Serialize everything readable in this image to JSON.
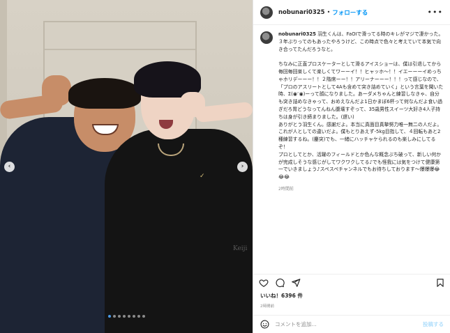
{
  "post": {
    "username": "nobunari0325",
    "follow_label": "フォローする",
    "separator": "•",
    "more_label": "•••",
    "photo_credit": "Keiji",
    "shirt_logo": "✓",
    "carousel": {
      "prev": "‹",
      "next": "›",
      "count": 8,
      "active_index": 0
    },
    "caption_text": "羽生くんは、FaOIで滑ってる時のキレがマジで凄かった。３年ぶりってのもあったやろうけど、この時点で色々と考えていて本気で向き合ってたんだろうなと。\n\nちなみに正直プロスケーターとして滑るアイスショーは、僕は引退してから毎回毎回楽しくて楽しくてワーーイ！！ヒャッホ〜！！イエーーーイめっちゃホリデーーー！！２階席ーー！！アリーナーーー！！！って感じなので、「プロのアスリートとして4Aも含めて突き詰めていく」という言葉を聞いた時、Σ(◉ᵔ◉)ーって顔になりました。あーダメちゃんと練習しなきゃ、自分も突き詰めなきゃって、おめえなんだよ1日かまぼ6杯って何なんだよ食い過ぎだろ胃どうなってんねん腹壊すぞって、35歳男性スイーツ大好き4人子持ちは身が引き締まりました。(遅い)\nありがとう羽生くん。感謝だよ。本当に真面目真摯努力唯一無二の人だよ。これが人としての違いだよ。僕もとりあえず-5kg目指して、４回転もあと2種練習するね。(鏖突)でも、一緒にハッチャケられるのも楽しみにしてるぞ！\nプロとしてとか、活躍のフィールドとか色んな概念ぶち破って、新しい何かが完成しそうな感じがしてワクワクしてる♪でも怪我には気をつけて健康第一でいきましょう♪スペスペチャンネルでもお待ちしております〜爆爆爆😂😂😂",
    "time_ago": "2時間前",
    "likes": "いいね！6396 件",
    "posted": "2時間前",
    "comment_placeholder": "コメントを追加...",
    "post_button": "投稿する"
  }
}
